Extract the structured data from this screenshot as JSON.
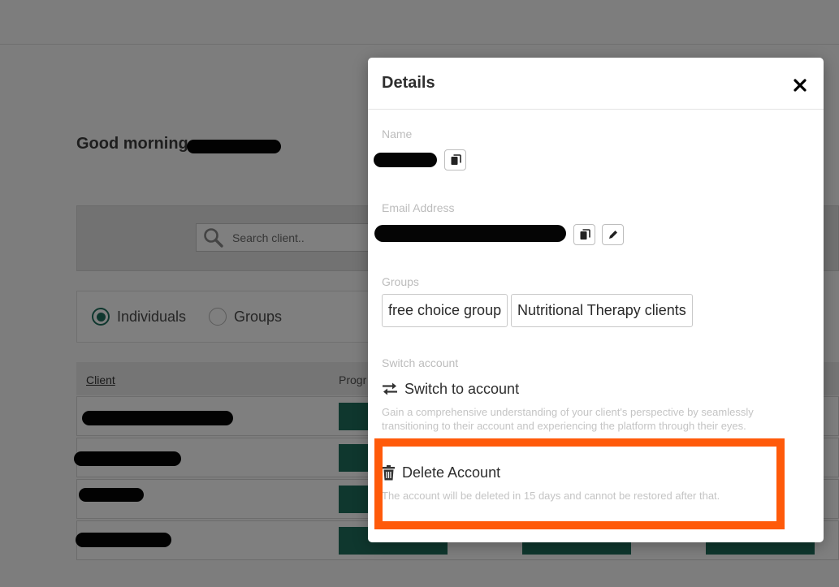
{
  "background": {
    "greeting": "Good morning",
    "search_placeholder": "Search client..",
    "filters": [
      {
        "label": "Individuals",
        "checked": true
      },
      {
        "label": "Groups",
        "checked": false
      }
    ],
    "table": {
      "col_client": "Client",
      "col_progress": "Progr"
    }
  },
  "modal": {
    "title": "Details",
    "close_icon": "close-icon",
    "name_label": "Name",
    "email_label": "Email Address",
    "groups_label": "Groups",
    "groups": [
      "free choice group",
      "Nutritional Therapy clients"
    ],
    "switch_section_label": "Switch account",
    "switch_label": "Switch to account",
    "switch_desc_line1": "Gain a comprehensive understanding of your client's perspective by seamlessly",
    "switch_desc_line2": "transitioning to their account and experiencing the platform through their eyes.",
    "delete_label": "Delete Account",
    "delete_desc": "The account will be deleted in 15 days and cannot be restored after that."
  },
  "colors": {
    "accent": "#1f6e5d",
    "highlight": "#ff5a0a"
  }
}
